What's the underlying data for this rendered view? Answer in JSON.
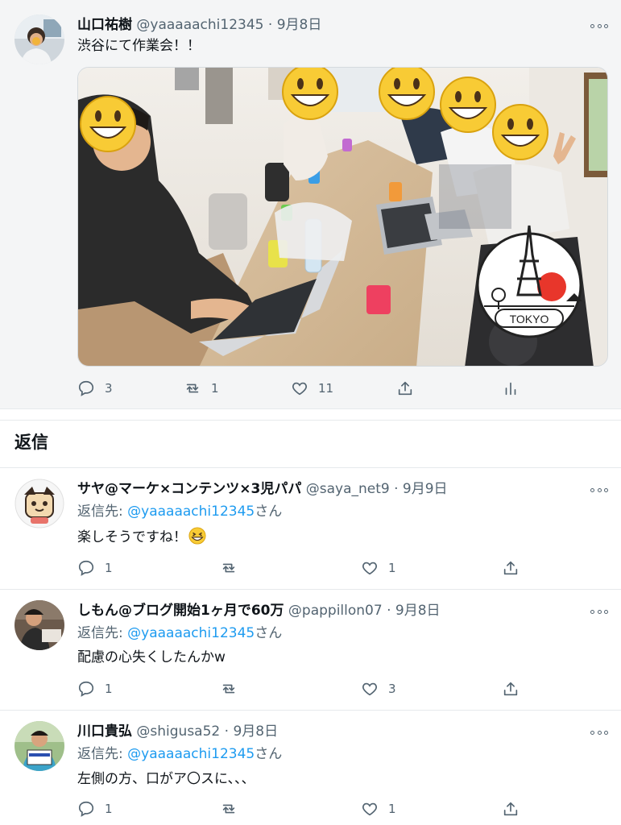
{
  "main_tweet": {
    "author_name": "山口祐樹",
    "handle": "@yaaaaachi12345",
    "separator": "·",
    "date": "9月8日",
    "text": "渋谷にて作業会！！",
    "image": {
      "badge_text": "TOKYO",
      "description_icon": "tokyo-tower-badge"
    },
    "actions": {
      "replies": "3",
      "retweets": "1",
      "likes": "11"
    }
  },
  "replies_section": {
    "title": "返信"
  },
  "replies": [
    {
      "author_name": "サヤ@マーケ×コンテンツ×3児パパ",
      "handle": "@saya_net9",
      "separator": "·",
      "date": "9月9日",
      "reply_to_prefix": "返信先: ",
      "reply_to_handle": "@yaaaaachi12345",
      "reply_to_suffix": "さん",
      "text": "楽しそうですね！",
      "emoji": "grinning-squinting-face",
      "replies": "1",
      "retweets": "",
      "likes": "1"
    },
    {
      "author_name": "しもん@ブログ開始1ヶ月で60万",
      "handle": "@pappillon07",
      "separator": "·",
      "date": "9月8日",
      "reply_to_prefix": "返信先: ",
      "reply_to_handle": "@yaaaaachi12345",
      "reply_to_suffix": "さん",
      "text": "配慮の心失くしたんかw",
      "replies": "1",
      "retweets": "",
      "likes": "3"
    },
    {
      "author_name": "川口貴弘",
      "handle": "@shigusa52",
      "separator": "·",
      "date": "9月8日",
      "reply_to_prefix": "返信先: ",
      "reply_to_handle": "@yaaaaachi12345",
      "reply_to_suffix": "さん",
      "text": "左側の方、口がア〇スに、、、",
      "replies": "1",
      "retweets": "",
      "likes": "1"
    }
  ],
  "colors": {
    "accent": "#1d9bf0",
    "secondary_text": "#536471",
    "main_tweet_bg": "#f4f5f6",
    "badge_red": "#e8362b"
  }
}
